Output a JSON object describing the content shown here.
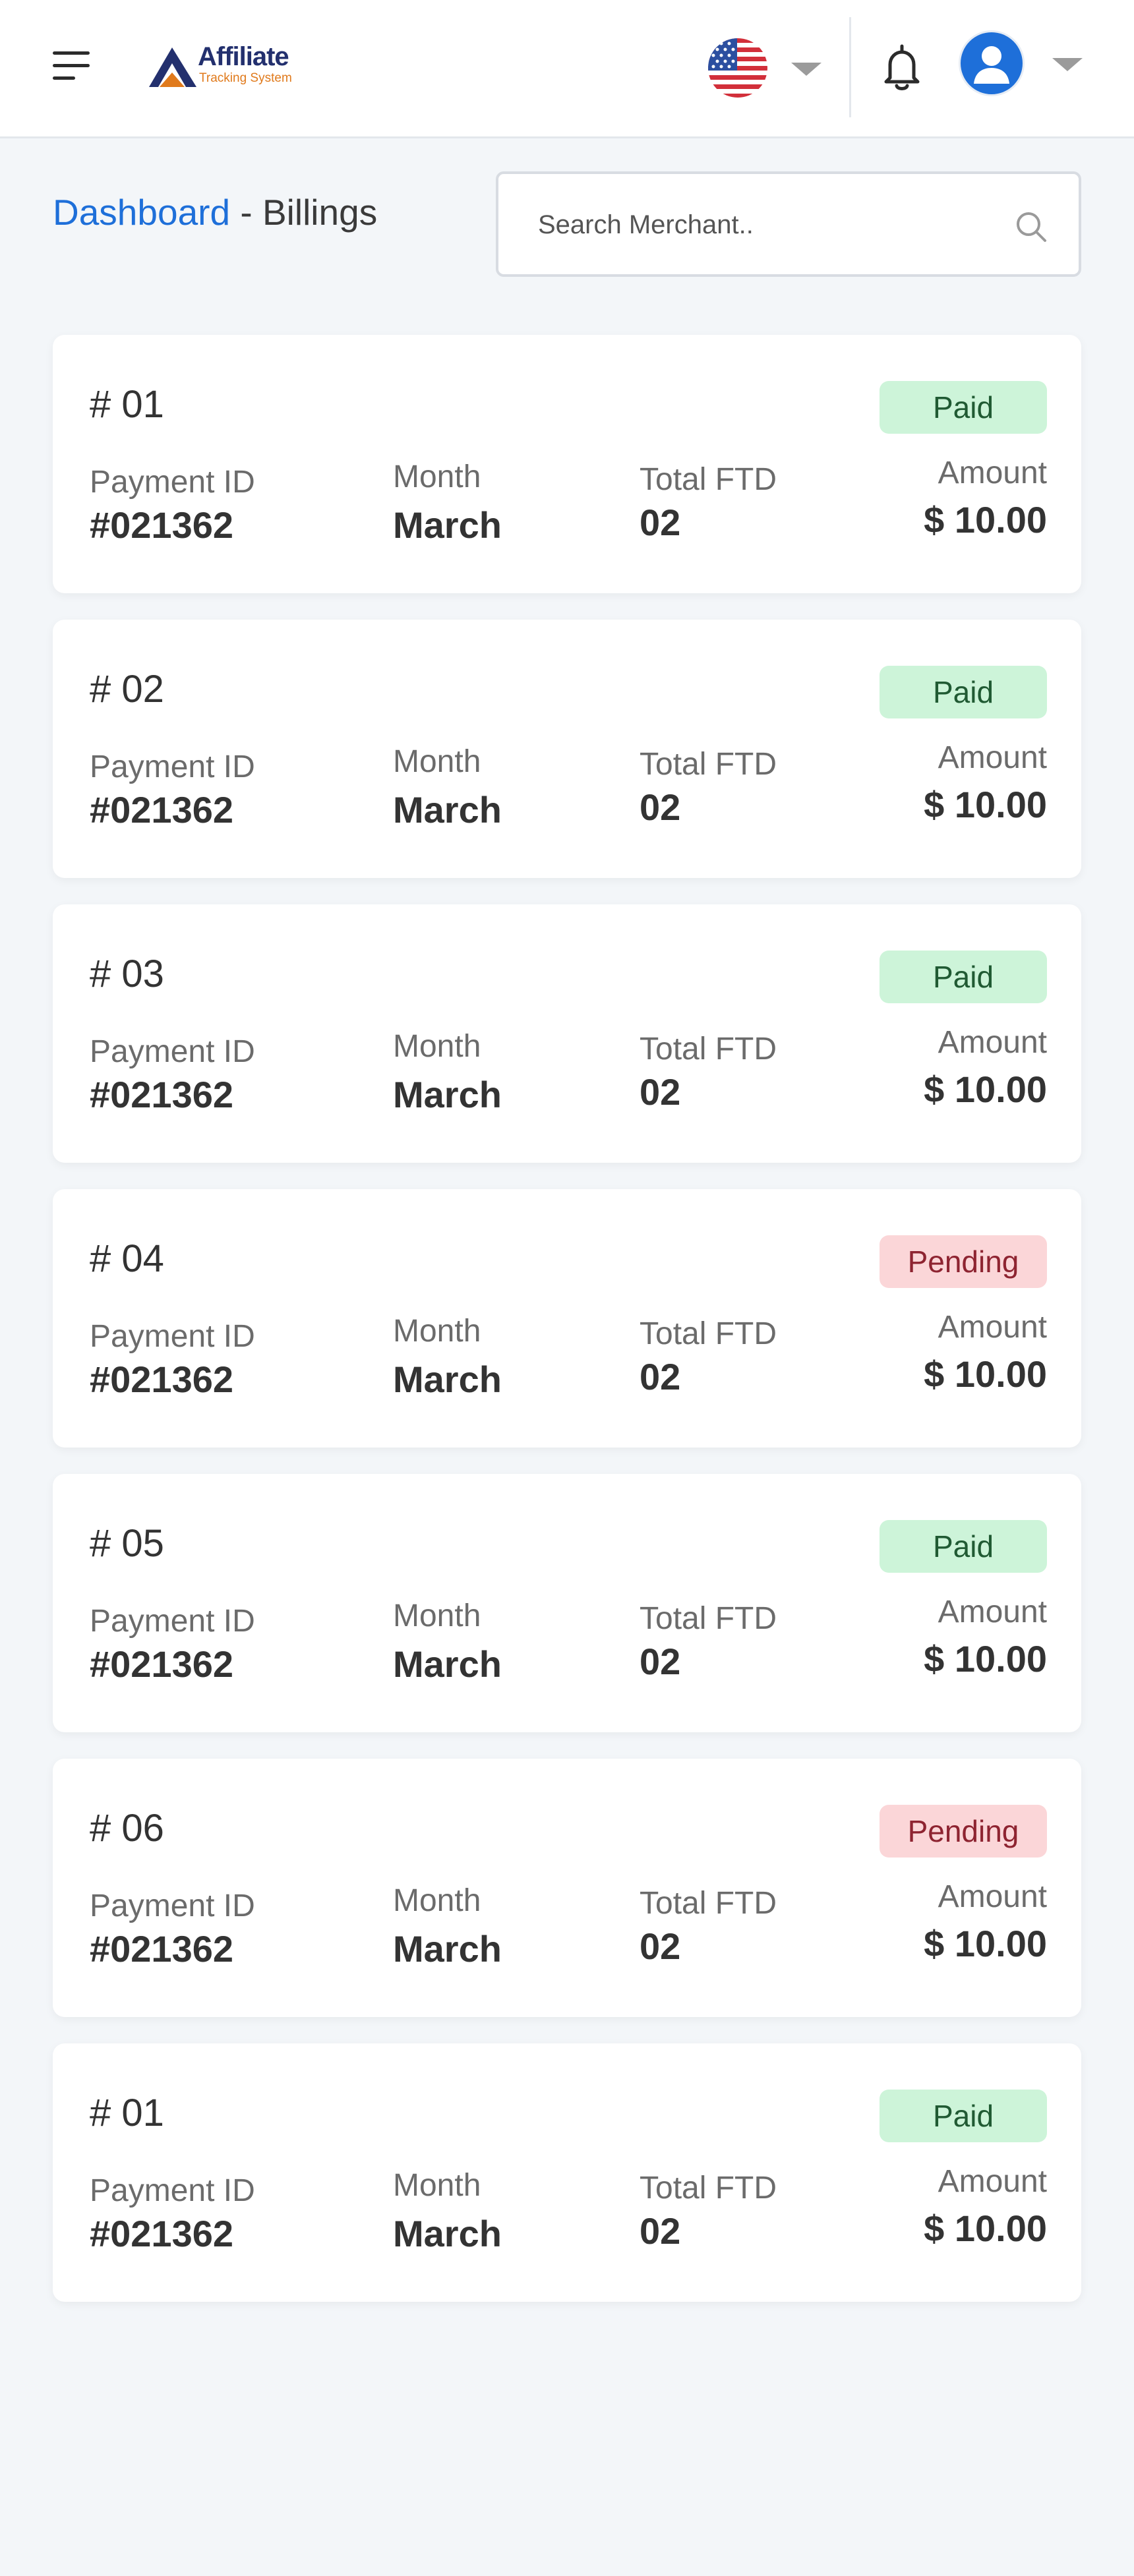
{
  "header": {
    "logo_title": "Affiliate",
    "logo_subtitle": "Tracking System",
    "language_icon": "us-flag-icon",
    "notification_icon": "bell-icon",
    "user_icon": "user-avatar-icon"
  },
  "breadcrumb": {
    "link": "Dashboard",
    "separator": " - ",
    "current": "Billings"
  },
  "search": {
    "placeholder": "Search Merchant.."
  },
  "labels": {
    "payment_id": "Payment ID",
    "month": "Month",
    "total_ftd": "Total FTD",
    "amount": "Amount"
  },
  "colors": {
    "accent": "#1e6fd9",
    "paid_bg": "#cdf4d9",
    "paid_text": "#205a33",
    "pending_bg": "#fbd6d8",
    "pending_text": "#8e2431"
  },
  "billings": [
    {
      "number": "# 01",
      "status": "Paid",
      "payment_id": "#021362",
      "month": "March",
      "total_ftd": "02",
      "amount": "$ 10.00"
    },
    {
      "number": "# 02",
      "status": "Paid",
      "payment_id": "#021362",
      "month": "March",
      "total_ftd": "02",
      "amount": "$ 10.00"
    },
    {
      "number": "# 03",
      "status": "Paid",
      "payment_id": "#021362",
      "month": "March",
      "total_ftd": "02",
      "amount": "$ 10.00"
    },
    {
      "number": "# 04",
      "status": "Pending",
      "payment_id": "#021362",
      "month": "March",
      "total_ftd": "02",
      "amount": "$ 10.00"
    },
    {
      "number": "# 05",
      "status": "Paid",
      "payment_id": "#021362",
      "month": "March",
      "total_ftd": "02",
      "amount": "$ 10.00"
    },
    {
      "number": "# 06",
      "status": "Pending",
      "payment_id": "#021362",
      "month": "March",
      "total_ftd": "02",
      "amount": "$ 10.00"
    },
    {
      "number": "# 01",
      "status": "Paid",
      "payment_id": "#021362",
      "month": "March",
      "total_ftd": "02",
      "amount": "$ 10.00"
    }
  ]
}
